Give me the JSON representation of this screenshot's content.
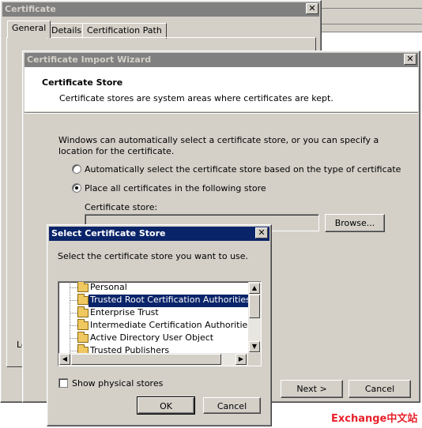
{
  "certificate_window": {
    "title": "Certificate",
    "close": "✕",
    "tabs": [
      "General",
      "Details",
      "Certification Path"
    ],
    "clipped_labels": [
      "Le",
      "Le"
    ]
  },
  "wizard": {
    "title": "Certificate Import Wizard",
    "close": "✕",
    "section_heading": "Certificate Store",
    "section_description": "Certificate stores are system areas where certificates are kept.",
    "intro_text": "Windows can automatically select a certificate store, or you can specify a location for the certificate.",
    "radio_auto_label": "Automatically select the certificate store based on the type of certificate",
    "radio_manual_label": "Place all certificates in the following store",
    "store_field_label": "Certificate store:",
    "store_field_value": "",
    "browse_label": "Browse...",
    "next_label": "Next >",
    "cancel_label": "Cancel"
  },
  "select_dialog": {
    "title": "Select Certificate Store",
    "close": "✕",
    "instruction": "Select the certificate store you want to use.",
    "stores": [
      "Personal",
      "Trusted Root Certification Authorities",
      "Enterprise Trust",
      "Intermediate Certification Authorities",
      "Active Directory User Object",
      "Trusted Publishers"
    ],
    "selected_store": "Trusted Root Certification Authorities",
    "show_physical_label": "Show physical stores",
    "ok_label": "OK",
    "cancel_label": "Cancel"
  },
  "watermark": "Exchange中文站",
  "colors": {
    "active_title": "#0a246a",
    "inactive_title": "#808080",
    "face": "#d4d0c8",
    "watermark": "#e8202a"
  }
}
